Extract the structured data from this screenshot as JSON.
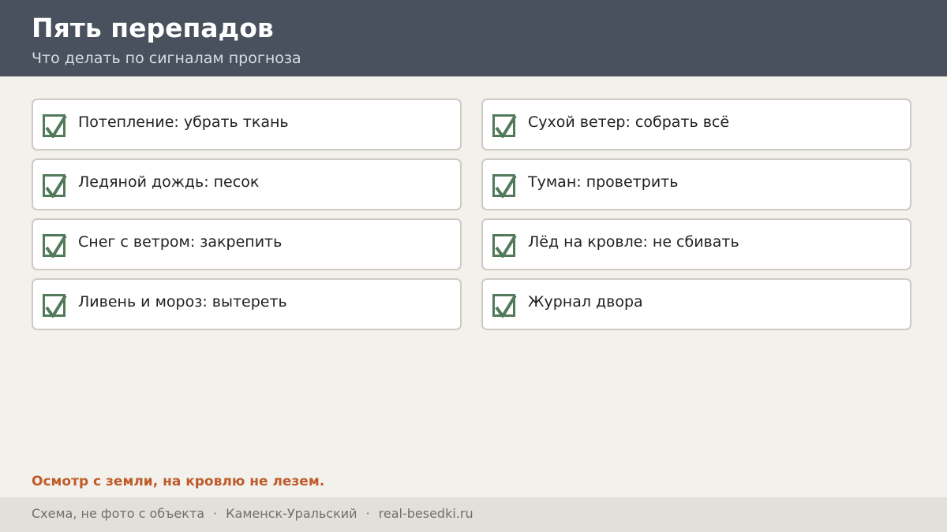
{
  "header": {
    "title": "Пять перепадов",
    "subtitle": "Что делать по сигналам прогноза"
  },
  "checklist": {
    "left": [
      {
        "label": "Потепление: убрать ткань",
        "checked": true
      },
      {
        "label": "Ледяной дождь: песок",
        "checked": true
      },
      {
        "label": "Снег с ветром: закрепить",
        "checked": true
      },
      {
        "label": "Ливень и мороз: вытереть",
        "checked": true
      }
    ],
    "right": [
      {
        "label": "Сухой ветер: собрать всё",
        "checked": true
      },
      {
        "label": "Туман: проветрить",
        "checked": true
      },
      {
        "label": "Лёд на кровле: не сбивать",
        "checked": true
      },
      {
        "label": "Журнал двора",
        "checked": true
      }
    ]
  },
  "note": "Осмотр с земли, на кровлю не лезем.",
  "footer": {
    "caption": "Схема, не фото с объекта",
    "city": "Каменск-Уральский",
    "site": "real-besedki.ru",
    "separator": "·"
  },
  "colors": {
    "header_bg": "#48515d",
    "check": "#517a5a",
    "accent": "#bf5b2a"
  }
}
